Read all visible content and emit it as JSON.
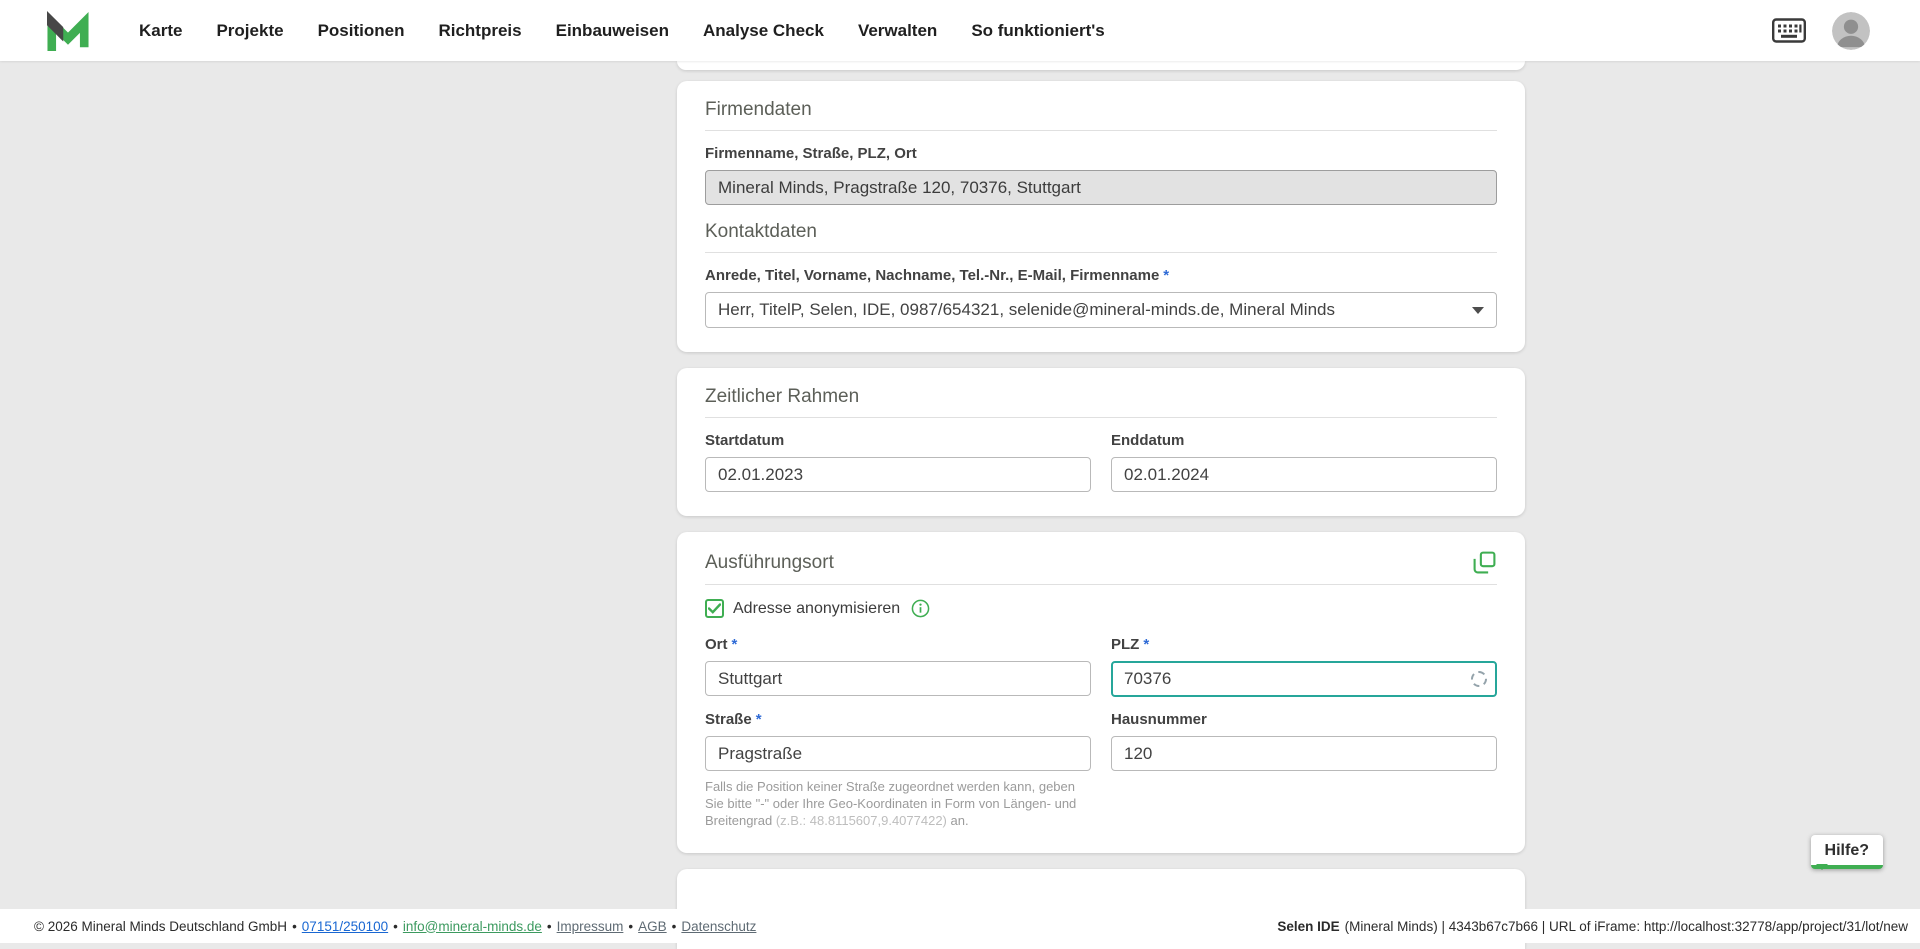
{
  "required_marker": "*",
  "colors": {
    "accent_green": "#3fae52",
    "focus_border": "#26a69a",
    "link_blue": "#1967d2",
    "required_asterisk": "#2f6bd6"
  },
  "nav": {
    "items": [
      {
        "label": "Karte"
      },
      {
        "label": "Projekte"
      },
      {
        "label": "Positionen"
      },
      {
        "label": "Richtpreis"
      },
      {
        "label": "Einbauweisen"
      },
      {
        "label": "Analyse Check"
      },
      {
        "label": "Verwalten"
      },
      {
        "label": "So funktioniert's"
      }
    ]
  },
  "firmendaten": {
    "title": "Firmendaten",
    "company_label": "Firmenname, Straße, PLZ, Ort",
    "company_value": "Mineral Minds, Pragstraße 120, 70376, Stuttgart",
    "kontakt_title": "Kontaktdaten",
    "kontakt_label": "Anrede, Titel, Vorname, Nachname, Tel.-Nr., E-Mail, Firmenname",
    "kontakt_value": "Herr, TitelP, Selen, IDE, 0987/654321, selenide@mineral-minds.de, Mineral Minds"
  },
  "zeitraum": {
    "title": "Zeitlicher Rahmen",
    "start_label": "Startdatum",
    "start_value": "02.01.2023",
    "end_label": "Enddatum",
    "end_value": "02.01.2024"
  },
  "ausfuehrungsort": {
    "title": "Ausführungsort",
    "anonymize_label": "Adresse anonymisieren",
    "anonymize_checked": true,
    "ort_label": "Ort",
    "ort_value": "Stuttgart",
    "plz_label": "PLZ",
    "plz_value": "70376",
    "strasse_label": "Straße",
    "strasse_value": "Pragstraße",
    "hausnummer_label": "Hausnummer",
    "hausnummer_value": "120",
    "hint_text": "Falls die Position keiner Straße zugeordnet werden kann, geben Sie bitte \"-\" oder Ihre Geo-Koordinaten in Form von Längen- und Breitengrad ",
    "hint_coords": "(z.B.: 48.8115607,9.4077422)",
    "hint_suffix": " an."
  },
  "help": {
    "label": "Hilfe?"
  },
  "footer": {
    "copyright": "© 2026 Mineral Minds Deutschland GmbH",
    "separator": "•",
    "phone": "07151/250100",
    "email": "info@mineral-minds.de",
    "link_impressum": "Impressum",
    "link_agb": "AGB",
    "link_datenschutz": "Datenschutz",
    "debug_bold": "Selen IDE",
    "debug_rest": " (Mineral Minds) | 4343b67c7b66 | URL of iFrame: http://localhost:32778/app/project/31/lot/new"
  }
}
